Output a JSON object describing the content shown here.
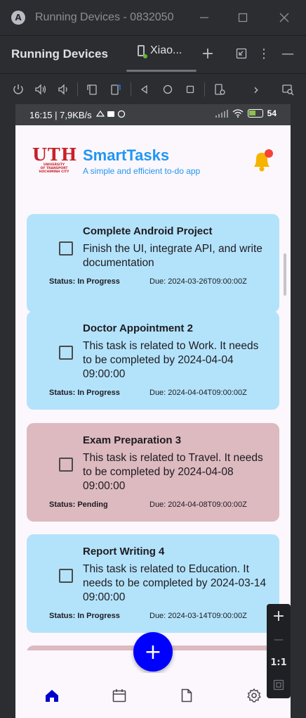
{
  "window": {
    "title": "Running Devices - 0832050",
    "logo": "A",
    "minimize_icon": "minimize-icon",
    "maximize_icon": "maximize-icon",
    "close_icon": "close-icon"
  },
  "tool_header": {
    "title": "Running Devices",
    "device_tab_label": "Xiao...",
    "add_symbol": "+",
    "menu_symbol": "⋮",
    "hide_symbol": "—"
  },
  "device_toolbar": {
    "icons": [
      "power-icon",
      "volume-up-icon",
      "volume-down-icon",
      "rotate-left-icon",
      "rotate-right-icon",
      "back-icon",
      "home-icon",
      "overview-icon",
      "snapshot-icon",
      "more-icon",
      "inspect-icon"
    ],
    "next_symbol": "›"
  },
  "status_bar": {
    "left": "16:15 | 7,9KB/s",
    "battery": "54"
  },
  "app": {
    "logo_text": "UTH",
    "logo_sub": [
      "UNIVERSITY",
      "OF TRANSPORT",
      "HOCHIMINH CITY"
    ],
    "title": "SmartTasks",
    "subtitle": "A simple and efficient to-do app",
    "accent_color": "#2196f3",
    "bell_color": "#f5b400",
    "badge_color": "#f44336"
  },
  "tasks": [
    {
      "title": "Complete Android Project",
      "description": "Finish the UI, integrate API, and write documentation",
      "status": "Status: In Progress",
      "due": "Due: 2024-03-26T09:00:00Z",
      "color": "blue"
    },
    {
      "title": "Doctor Appointment 2",
      "description": "This task is related to Work. It needs to be completed by 2024-04-04 09:00:00",
      "status": "Status: In Progress",
      "due": "Due: 2024-04-04T09:00:00Z",
      "color": "blue"
    },
    {
      "title": "Exam Preparation 3",
      "description": "This task is related to Travel. It needs to be completed by 2024-04-08 09:00:00",
      "status": "Status: Pending",
      "due": "Due: 2024-04-08T09:00:00Z",
      "color": "pink"
    },
    {
      "title": "Report Writing 4",
      "description": "This task is related to Education. It needs to be completed by 2024-03-14 09:00:00",
      "status": "Status: In Progress",
      "due": "Due: 2024-03-14T09:00:00Z",
      "color": "blue"
    }
  ],
  "fab": {
    "symbol": "+",
    "color": "#0000ff"
  },
  "bottom_nav": {
    "items": [
      "home-icon",
      "calendar-icon",
      "document-icon",
      "settings-icon"
    ],
    "active_color": "#0000cc"
  },
  "zoom": {
    "plus": "+",
    "minus": "—",
    "ratio": "1:1"
  }
}
